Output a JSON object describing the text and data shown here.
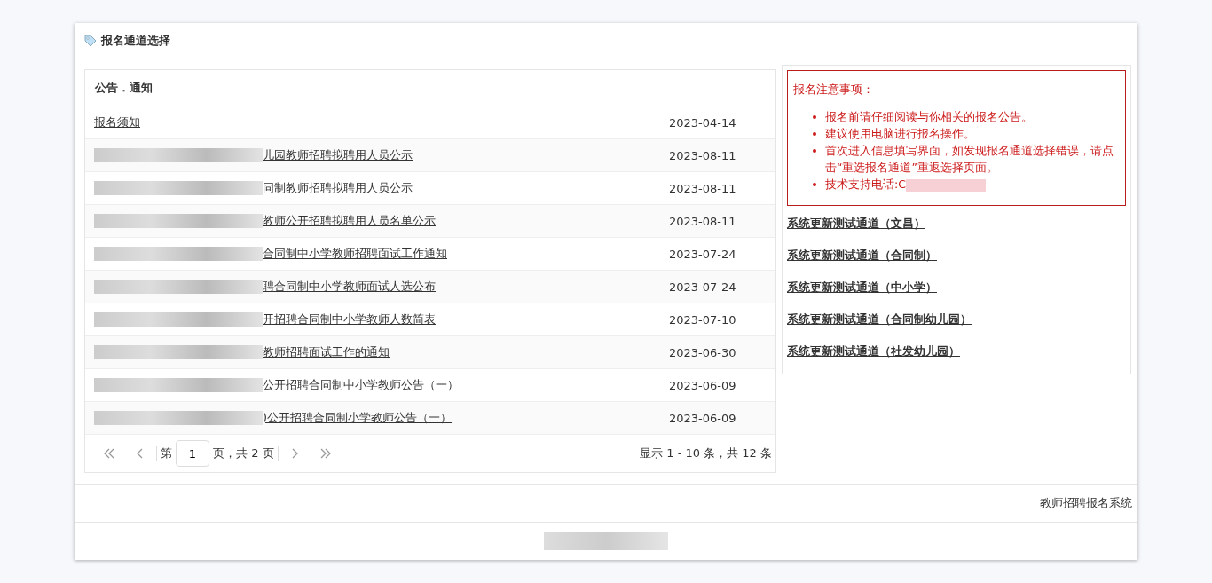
{
  "header": {
    "title": "报名通道选择"
  },
  "notices": {
    "title": "公告．通知",
    "rows": [
      {
        "title": "报名须知",
        "date": "2023-04-14",
        "redacted": false
      },
      {
        "title": "儿园教师招聘拟聘用人员公示",
        "date": "2023-08-11",
        "redacted": true
      },
      {
        "title": "同制教师招聘拟聘用人员公示",
        "date": "2023-08-11",
        "redacted": true
      },
      {
        "title": "教师公开招聘拟聘用人员名单公示",
        "date": "2023-08-11",
        "redacted": true
      },
      {
        "title": "合同制中小学教师招聘面试工作通知",
        "date": "2023-07-24",
        "redacted": true
      },
      {
        "title": "聘合同制中小学教师面试人选公布",
        "date": "2023-07-24",
        "redacted": true
      },
      {
        "title": "开招聘合同制中小学教师人数简表",
        "date": "2023-07-10",
        "redacted": true
      },
      {
        "title": "教师招聘面试工作的通知",
        "date": "2023-06-30",
        "redacted": true
      },
      {
        "title": "公开招聘合同制中小学教师公告（一）",
        "date": "2023-06-09",
        "redacted": true
      },
      {
        "title": ")公开招聘合同制小学教师公告（一）",
        "date": "2023-06-09",
        "redacted": true
      }
    ],
    "pager": {
      "prefix": "第",
      "page": "1",
      "suffix": "页，共 2 页",
      "summary": "显示 1 - 10 条，共 12 条"
    }
  },
  "notice_box": {
    "title": "报名注意事项：",
    "items": [
      {
        "text": "报名前请仔细阅读与你相关的报名公告。",
        "redacted": false
      },
      {
        "text": "建议使用电脑进行报名操作。",
        "redacted": false
      },
      {
        "text": "首次进入信息填写界面，如发现报名通道选择错误，请点击“重选报名通道”重返选择页面。",
        "redacted": false
      },
      {
        "text": "技术支持电话:C",
        "redacted": true
      }
    ]
  },
  "channels": [
    "系统更新测试通道（文昌）",
    "系统更新测试通道（合同制）",
    "系统更新测试通道（中小学）",
    "系统更新测试通道（合同制幼儿园）",
    "系统更新测试通道（社发幼儿园）"
  ],
  "footer": {
    "system_name": "教师招聘报名系统"
  }
}
